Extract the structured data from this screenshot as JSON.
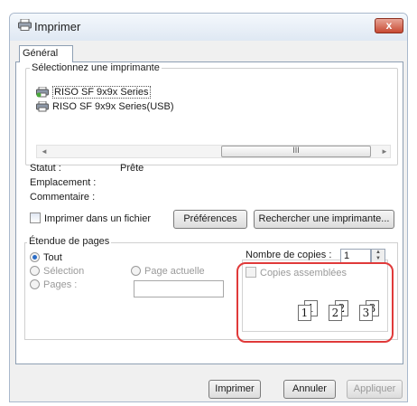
{
  "window": {
    "title": "Imprimer",
    "close_glyph": "x"
  },
  "tabs": [
    {
      "label": "Général"
    }
  ],
  "printer_group": {
    "legend": "Sélectionnez une imprimante",
    "printers": [
      {
        "name": "RISO SF 9x9x Series",
        "selected": true
      },
      {
        "name": "RISO SF 9x9x Series(USB)",
        "selected": false
      }
    ],
    "scroll_thumb_glyph": "III",
    "status_label": "Statut :",
    "status_value": "Prête",
    "location_label": "Emplacement :",
    "comment_label": "Commentaire :",
    "print_to_file_label": "Imprimer dans un fichier",
    "preferences_button": "Préférences",
    "find_printer_button": "Rechercher une imprimante..."
  },
  "page_range": {
    "legend": "Étendue de pages",
    "options": [
      {
        "label": "Tout",
        "selected": true,
        "enabled": true
      },
      {
        "label": "Sélection",
        "selected": false,
        "enabled": false
      },
      {
        "label": "Page actuelle",
        "selected": false,
        "enabled": false
      },
      {
        "label": "Pages :",
        "selected": false,
        "enabled": false
      }
    ],
    "pages_value": ""
  },
  "copies": {
    "label": "Nombre de copies :",
    "value": "1",
    "collate_label": "Copies assemblées",
    "collate_checked": false,
    "preview_numbers": [
      "1",
      "1",
      "2",
      "2",
      "3",
      "3"
    ]
  },
  "footer": {
    "print_button": "Imprimer",
    "cancel_button": "Annuler",
    "apply_button": "Appliquer"
  },
  "colors": {
    "highlight_ring": "#e03a3a",
    "radio_dot": "#2a6cc6",
    "close_button": "#c74a33"
  }
}
